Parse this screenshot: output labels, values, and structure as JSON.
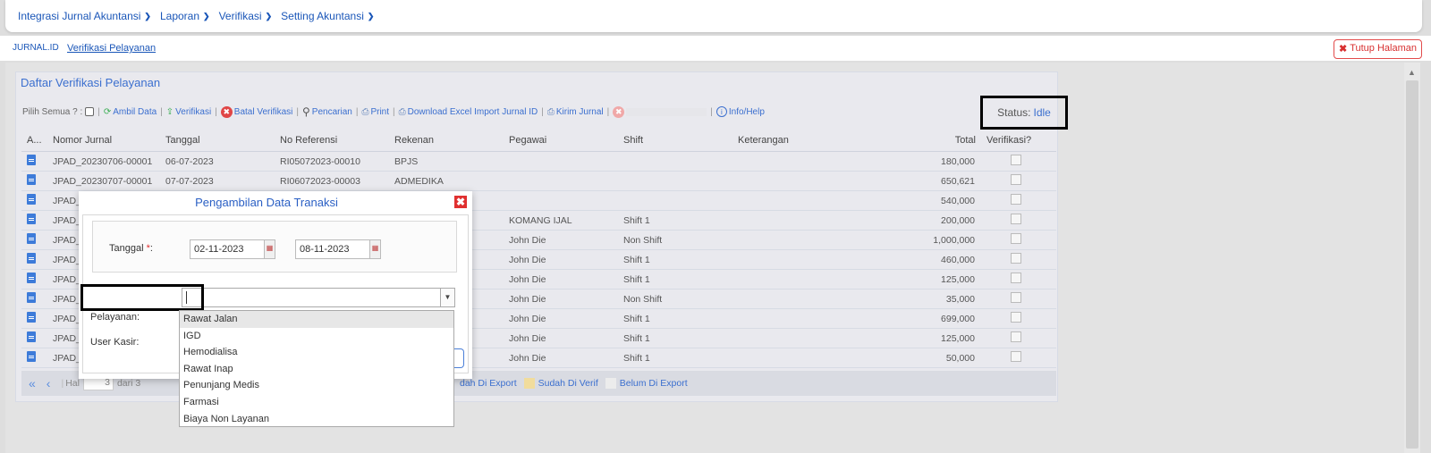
{
  "nav": {
    "items": [
      {
        "label": "Integrasi Jurnal Akuntansi"
      },
      {
        "label": "Laporan"
      },
      {
        "label": "Verifikasi"
      },
      {
        "label": "Setting Akuntansi"
      }
    ]
  },
  "breadcrumb": {
    "root": "JURNAL.ID",
    "current": "Verifikasi Pelayanan"
  },
  "close_page": "Tutup Halaman",
  "panel": {
    "title": "Daftar Verifikasi Pelayanan",
    "toolbar": {
      "pilih_semua": "Pilih Semua ? :",
      "ambil_data": "Ambil Data",
      "verifikasi": "Verifikasi",
      "batal_verifikasi": "Batal Verifikasi",
      "pencarian": "Pencarian",
      "print": "Print",
      "download_excel": "Download Excel Import Jurnal ID",
      "kirim_jurnal": "Kirim Jurnal",
      "info_help": "Info/Help"
    },
    "status_label": "Status:",
    "status_value": "Idle"
  },
  "grid": {
    "columns": [
      "A...",
      "Nomor Jurnal",
      "Tanggal",
      "No Referensi",
      "Rekenan",
      "Pegawai",
      "Shift",
      "Keterangan",
      "Total",
      "Verifikasi?"
    ],
    "rows": [
      {
        "nomor": "JPAD_20230706-00001",
        "tanggal": "06-07-2023",
        "ref": "RI05072023-00010",
        "rekanan": "BPJS",
        "pegawai": "",
        "shift": "",
        "ket": "",
        "total": "180,000"
      },
      {
        "nomor": "JPAD_20230707-00001",
        "tanggal": "07-07-2023",
        "ref": "RI06072023-00003",
        "rekanan": "ADMEDIKA",
        "pegawai": "",
        "shift": "",
        "ket": "",
        "total": "650,621"
      },
      {
        "nomor": "JPAD_",
        "tanggal": "",
        "ref": "",
        "rekanan": "",
        "pegawai": "",
        "shift": "",
        "ket": "",
        "total": "540,000"
      },
      {
        "nomor": "JPAD_",
        "tanggal": "",
        "ref": "",
        "rekanan": "",
        "pegawai": "KOMANG IJAL",
        "shift": "Shift 1",
        "ket": "",
        "total": "200,000"
      },
      {
        "nomor": "JPAD_",
        "tanggal": "",
        "ref": "",
        "rekanan": "",
        "pegawai": "John Die",
        "shift": "Non Shift",
        "ket": "",
        "total": "1,000,000"
      },
      {
        "nomor": "JPAD_",
        "tanggal": "",
        "ref": "",
        "rekanan": "",
        "pegawai": "John Die",
        "shift": "Shift 1",
        "ket": "",
        "total": "460,000"
      },
      {
        "nomor": "JPAD_",
        "tanggal": "",
        "ref": "",
        "rekanan": "",
        "pegawai": "John Die",
        "shift": "Shift 1",
        "ket": "",
        "total": "125,000"
      },
      {
        "nomor": "JPAD_",
        "tanggal": "",
        "ref": "",
        "rekanan": "",
        "pegawai": "John Die",
        "shift": "Non Shift",
        "ket": "",
        "total": "35,000"
      },
      {
        "nomor": "JPAD_",
        "tanggal": "",
        "ref": "",
        "rekanan": "",
        "pegawai": "John Die",
        "shift": "Shift 1",
        "ket": "",
        "total": "699,000"
      },
      {
        "nomor": "JPAD_",
        "tanggal": "",
        "ref": "",
        "rekanan": "",
        "pegawai": "John Die",
        "shift": "Shift 1",
        "ket": "",
        "total": "125,000"
      },
      {
        "nomor": "JPAD_",
        "tanggal": "",
        "ref": "",
        "rekanan": "",
        "pegawai": "John Die",
        "shift": "Shift 1",
        "ket": "",
        "total": "50,000"
      }
    ]
  },
  "pager": {
    "hal": "Hal",
    "page": "3",
    "of": "dari 3",
    "legend": {
      "sudah_export": "dah Di Export",
      "sudah_verif": "Sudah Di Verif",
      "belum_export": "Belum Di Export",
      "verif_color": "#f1dc9c",
      "belum_color": "#ececec"
    }
  },
  "modal": {
    "title": "Pengambilan Data Tranaksi",
    "tanggal_label": "Tanggal",
    "req_mark": "*",
    "tanggal_suffix": ":",
    "date_from": "02-11-2023",
    "date_to": "08-11-2023",
    "pelayanan_label": "Pelayanan:",
    "user_kasir_label": "User Kasir:",
    "options": [
      "Rawat Jalan",
      "IGD",
      "Hemodialisa",
      "Rawat Inap",
      "Penunjang Medis",
      "Farmasi",
      "Biaya Non Layanan"
    ]
  },
  "colors": {
    "accent": "#1a56b8",
    "danger": "#e03030"
  }
}
